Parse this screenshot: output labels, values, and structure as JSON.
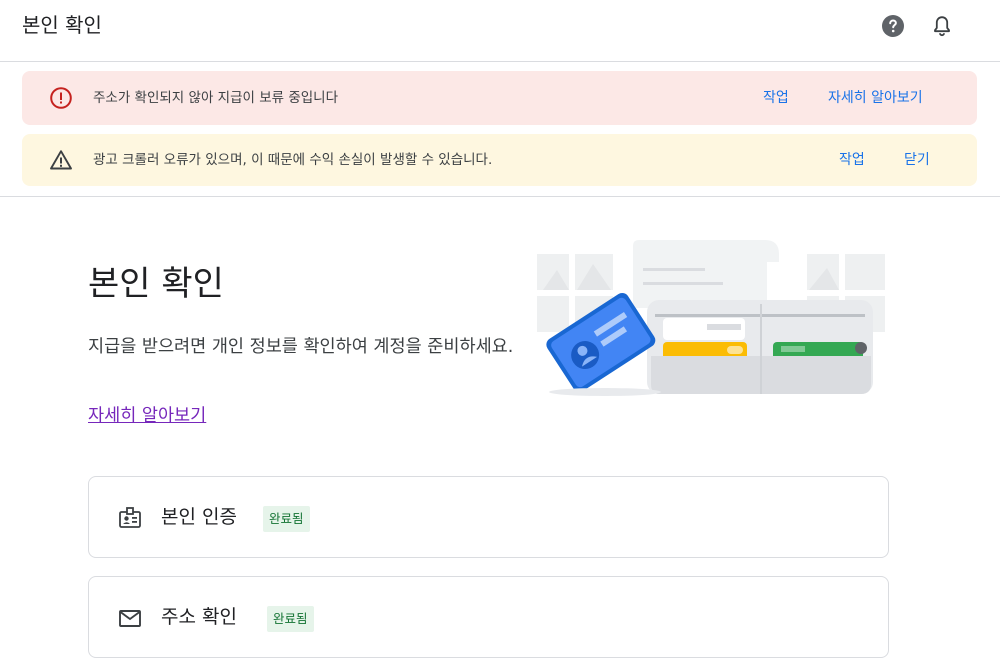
{
  "header": {
    "title": "본인 확인",
    "help_icon": "help-circle-icon",
    "notifications_icon": "bell-icon"
  },
  "banners": {
    "error": {
      "icon": "error-circle-icon",
      "message": "주소가 확인되지 않아 지급이 보류 중입니다",
      "action_label": "작업",
      "learn_more_label": "자세히 알아보기",
      "color": "#fce8e6",
      "icon_color": "#c5221f"
    },
    "warning": {
      "icon": "warning-triangle-icon",
      "message": "광고 크롤러 오류가 있으며, 이 때문에 수익 손실이 발생할 수 있습니다.",
      "action_label": "작업",
      "close_label": "닫기",
      "color": "#fef7e0"
    }
  },
  "hero": {
    "title": "본인 확인",
    "description": "지급을 받으려면 개인 정보를 확인하여 계정을 준비하세요.",
    "learn_more_label": "자세히 알아보기"
  },
  "steps": [
    {
      "icon": "id-badge-icon",
      "label": "본인 인증",
      "status": "완료됨"
    },
    {
      "icon": "mail-icon",
      "label": "주소 확인",
      "status": "완료됨"
    }
  ],
  "colors": {
    "link": "#1a73e8",
    "visited_link": "#7627bb",
    "success_text": "#137333",
    "success_bg": "#e6f4ea"
  }
}
